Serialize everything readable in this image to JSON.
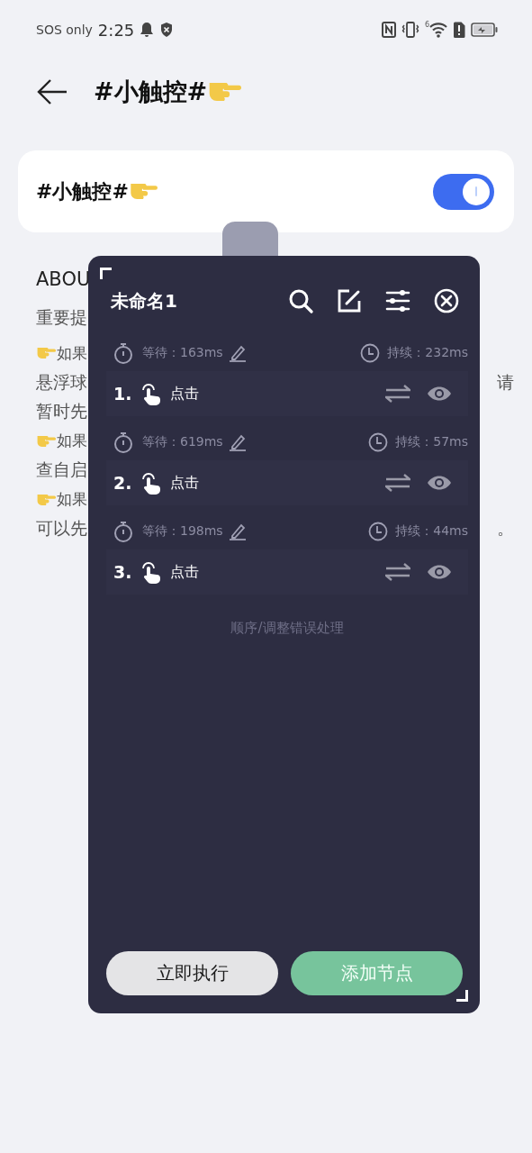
{
  "status_bar": {
    "carrier": "SOS only",
    "time": "2:25",
    "wifi_badge": "6"
  },
  "header": {
    "title": "#小触控#"
  },
  "toggle_card": {
    "label": "#小触控#",
    "on": true
  },
  "background_text": {
    "heading": "ABOU",
    "note": "重要提",
    "lines": [
      {
        "left": "如果",
        "pointer": true
      },
      {
        "left": "悬浮球",
        "right": "请"
      },
      {
        "left": "暂时先"
      },
      {
        "left": "如果",
        "pointer": true
      },
      {
        "left": "查自启"
      },
      {
        "left": "如果",
        "pointer": true
      },
      {
        "left": "可以先",
        "right": "。"
      }
    ]
  },
  "panel": {
    "title": "未命名1",
    "nodes": [
      {
        "index": "1.",
        "action": "点击",
        "wait": "等待：163ms",
        "duration": "持续：232ms"
      },
      {
        "index": "2.",
        "action": "点击",
        "wait": "等待：619ms",
        "duration": "持续：57ms"
      },
      {
        "index": "3.",
        "action": "点击",
        "wait": "等待：198ms",
        "duration": "持续：44ms"
      }
    ],
    "footer_link": "顺序/调整错误处理",
    "buttons": [
      {
        "label": "立即执行",
        "kind": "secondary"
      },
      {
        "label": "添加节点",
        "kind": "primary"
      }
    ]
  }
}
